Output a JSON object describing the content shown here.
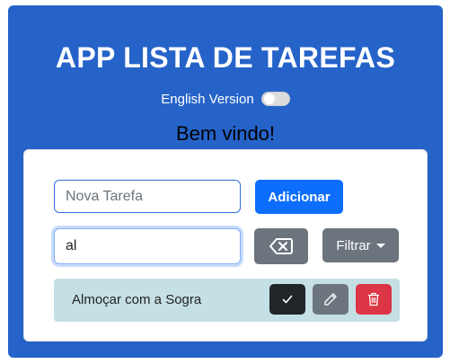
{
  "header": {
    "title": "APP LISTA DE TAREFAS",
    "language_toggle_label": "English Version",
    "welcome": "Bem vindo!"
  },
  "form": {
    "task_input_placeholder": "Nova Tarefa",
    "task_input_value": "",
    "add_button_label": "Adicionar",
    "filter_input_value": "al",
    "clear_icon": "backspace-icon",
    "filter_button_label": "Filtrar"
  },
  "tasks": [
    {
      "text": "Almoçar com a Sogra",
      "actions": [
        "check-icon",
        "pencil-icon",
        "trash-icon"
      ]
    }
  ],
  "colors": {
    "app_bg": "#2563c9",
    "primary": "#0d6efd",
    "secondary": "#6c757d",
    "dark": "#212529",
    "danger": "#dc3545",
    "task_row_bg": "#c5e0e4"
  }
}
